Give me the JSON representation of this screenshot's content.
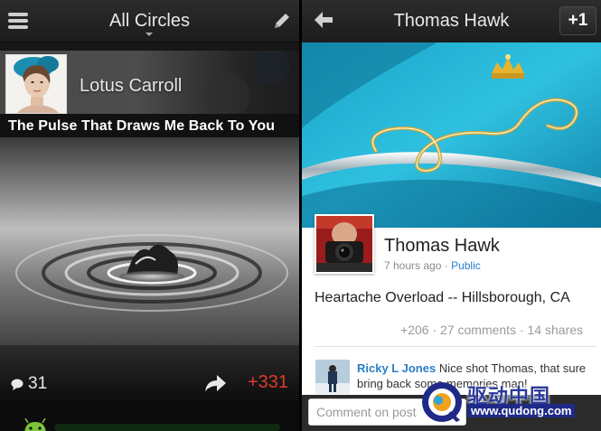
{
  "left_pane": {
    "header": {
      "title": "All Circles",
      "menu_icon": "menu-icon",
      "compose_icon": "pencil-icon"
    },
    "post": {
      "author": "Lotus Carroll",
      "title": "The Pulse That Draws Me Back To You",
      "comment_count": "31",
      "plusone_count": "+331",
      "comment_icon": "speech-bubble-icon",
      "share_icon": "share-arrow-icon",
      "accent_color": "#e03a2c"
    }
  },
  "right_pane": {
    "header": {
      "title": "Thomas Hawk",
      "back_icon": "back-arrow-icon",
      "plusone_label": "+1"
    },
    "post": {
      "author": "Thomas Hawk",
      "time": "7 hours ago",
      "separator": "·",
      "visibility": "Public",
      "text": "Heartache Overload -- Hillsborough, CA",
      "stats": "+206 · 27 comments · 14 shares",
      "link_color": "#2a7fc8"
    },
    "comment": {
      "author": "Ricky L Jones",
      "text": "Nice shot Thomas, that sure bring back some memories man!"
    },
    "comment_input": {
      "placeholder": "Comment on post"
    }
  },
  "watermark": {
    "chinese_text": "驱动中国",
    "url": "www.qudong.com"
  }
}
